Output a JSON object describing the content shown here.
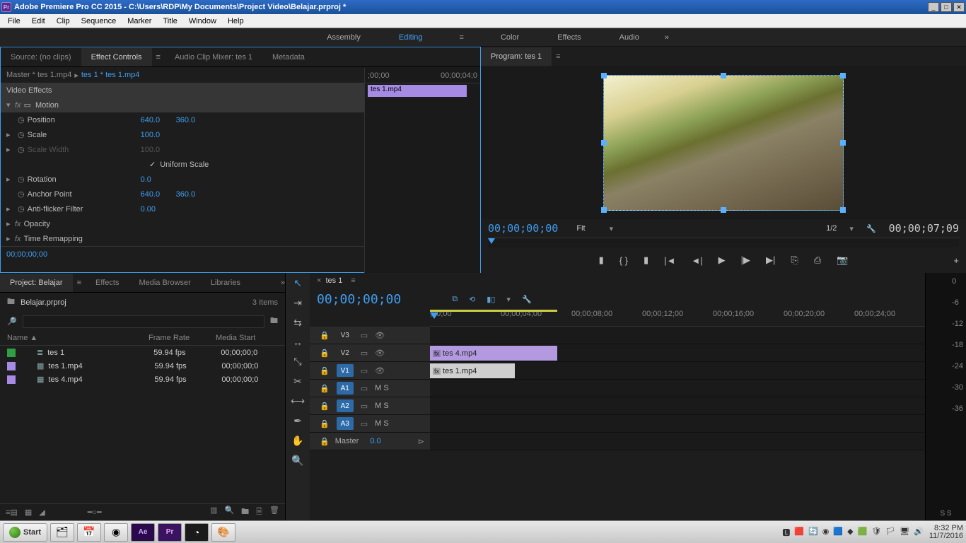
{
  "window": {
    "title": "Adobe Premiere Pro CC 2015 - C:\\Users\\RDP\\My Documents\\Project Video\\Belajar.prproj *",
    "app_badge": "Pr"
  },
  "menubar": [
    "File",
    "Edit",
    "Clip",
    "Sequence",
    "Marker",
    "Title",
    "Window",
    "Help"
  ],
  "workspaces": [
    "Assembly",
    "Editing",
    "Color",
    "Effects",
    "Audio"
  ],
  "workspace_active": "Editing",
  "source_panel": {
    "tabs": [
      "Source: (no clips)",
      "Effect Controls",
      "Audio Clip Mixer: tes 1",
      "Metadata"
    ],
    "active_tab": "Effect Controls",
    "master": "Master * tes 1.mp4",
    "sequence": "tes 1 * tes 1.mp4",
    "section": "Video Effects",
    "motion": "Motion",
    "position": {
      "label": "Position",
      "x": "640.0",
      "y": "360.0"
    },
    "scale": {
      "label": "Scale",
      "v": "100.0"
    },
    "scale_width": {
      "label": "Scale Width",
      "v": "100.0"
    },
    "uniform": "Uniform Scale",
    "rotation": {
      "label": "Rotation",
      "v": "0.0"
    },
    "anchor": {
      "label": "Anchor Point",
      "x": "640.0",
      "y": "360.0"
    },
    "flicker": {
      "label": "Anti-flicker Filter",
      "v": "0.00"
    },
    "opacity": "Opacity",
    "remap": "Time Remapping",
    "tc": "00;00;00;00",
    "mini_ruler": [
      ";00;00",
      "00;00;04;0"
    ],
    "mini_clip": "tes 1.mp4"
  },
  "program": {
    "tab": "Program: tes 1",
    "tc_left": "00;00;00;00",
    "fit": "Fit",
    "zoom": "1/2",
    "tc_right": "00;00;07;09"
  },
  "transport_icons": [
    "❚◄",
    "{ }",
    "►❚",
    "|◄",
    "◄|",
    "►",
    "|►",
    "►|",
    "⎙",
    "✂",
    "📷"
  ],
  "project": {
    "tabs": [
      "Project: Belajar",
      "Effects",
      "Media Browser",
      "Libraries"
    ],
    "active_tab": "Project: Belajar",
    "file": "Belajar.prproj",
    "count": "3 Items",
    "search_placeholder": "",
    "headers": [
      "Name ▲",
      "Frame Rate",
      "Media Start"
    ],
    "items": [
      {
        "swatch": "sw-green",
        "icon": "≣",
        "name": "tes 1",
        "fps": "59.94 fps",
        "start": "00;00;00;0"
      },
      {
        "swatch": "sw-pur1",
        "icon": "▦",
        "name": "tes 1.mp4",
        "fps": "59.94 fps",
        "start": "00;00;00;0"
      },
      {
        "swatch": "sw-pur2",
        "icon": "▦",
        "name": "tes 4.mp4",
        "fps": "59.94 fps",
        "start": "00;00;00;0"
      }
    ]
  },
  "timeline": {
    "tab": "tes 1",
    "tc": "00;00;00;00",
    "marks": [
      ";00;00",
      "00;00;04;00",
      "00;00;08;00",
      "00;00;12;00",
      "00;00;16;00",
      "00;00;20;00",
      "00;00;24;00"
    ],
    "tracks": {
      "v3": "V3",
      "v2": "V2",
      "v1": "V1",
      "a1": "A1",
      "a2": "A2",
      "a3": "A3",
      "master": "Master",
      "master_val": "0.0"
    },
    "clips": {
      "v2": "tes 4.mp4",
      "v1": "tes 1.mp4"
    },
    "audio_flags": "M  S"
  },
  "meters": {
    "scale": [
      "0",
      "-6",
      "-12",
      "-18",
      "-24",
      "-30",
      "-36"
    ],
    "mode": "S  S"
  },
  "taskbar": {
    "start": "Start",
    "time": "8:32 PM",
    "date": "11/7/2016"
  }
}
